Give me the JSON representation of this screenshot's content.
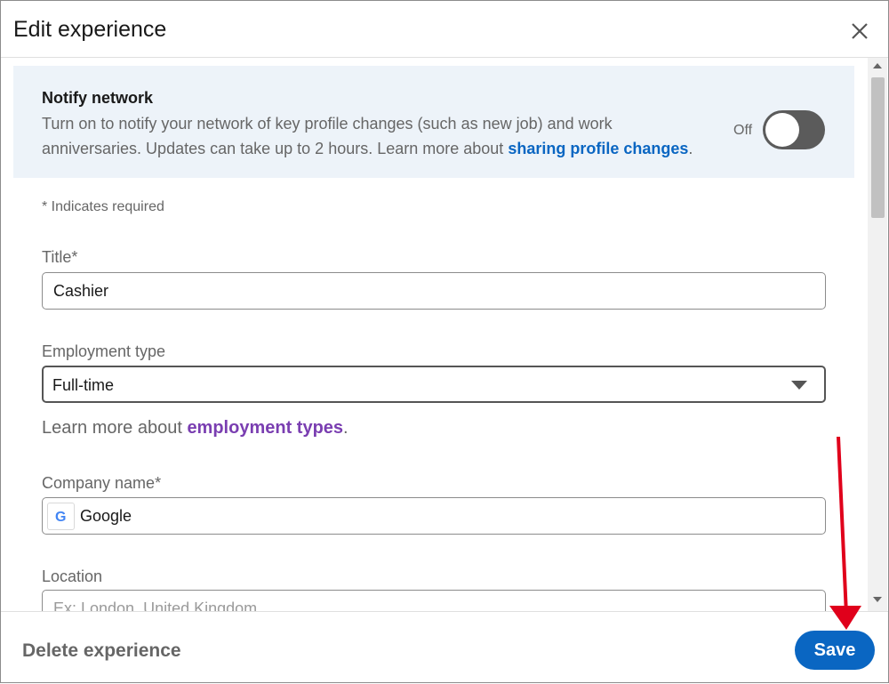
{
  "header": {
    "title": "Edit experience"
  },
  "notify": {
    "title": "Notify network",
    "desc_line1": "Turn on to notify your network of key profile changes (such as new job) and work",
    "desc_line2": "anniversaries. Updates can take up to 2 hours. Learn more about ",
    "link": "sharing profile changes",
    "link_end": ".",
    "toggle_state": "Off"
  },
  "form": {
    "required_note": "* Indicates required",
    "title_label": "Title*",
    "title_value": "Cashier",
    "employment_label": "Employment type",
    "employment_value": "Full-time",
    "learn_prefix": "Learn more about ",
    "learn_link": "employment types",
    "learn_suffix": ".",
    "company_label": "Company name*",
    "company_value": "Google",
    "company_logo": "G",
    "location_label": "Location",
    "location_placeholder": "Ex: London, United Kingdom"
  },
  "footer": {
    "delete_label": "Delete experience",
    "save_label": "Save"
  },
  "colors": {
    "accent": "#0a66c2",
    "link_purple": "#7a3eb1",
    "annotation_arrow": "#e0001b"
  }
}
